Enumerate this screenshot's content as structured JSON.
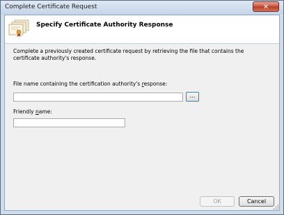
{
  "window": {
    "title": "Complete Certificate Request",
    "close_glyph": "✕"
  },
  "header": {
    "title": "Specify Certificate Authority Response",
    "icon": "certificate-icon"
  },
  "body": {
    "description": "Complete a previously created certificate request by retrieving the file that contains the certificate authority's response.",
    "file_label_pre": "File name containing the certification authority's ",
    "file_label_accel": "r",
    "file_label_post": "esponse:",
    "file_value": "",
    "browse_label": "...",
    "friendly_label_pre": "Friendly ",
    "friendly_label_accel": "n",
    "friendly_label_post": "ame:",
    "friendly_value": ""
  },
  "footer": {
    "ok_label": "OK",
    "cancel_label": "Cancel",
    "ok_enabled": false
  },
  "colors": {
    "window_frame": "#cfdcec",
    "client_background": "#f0f0f0",
    "close_button": "#c7513b"
  }
}
